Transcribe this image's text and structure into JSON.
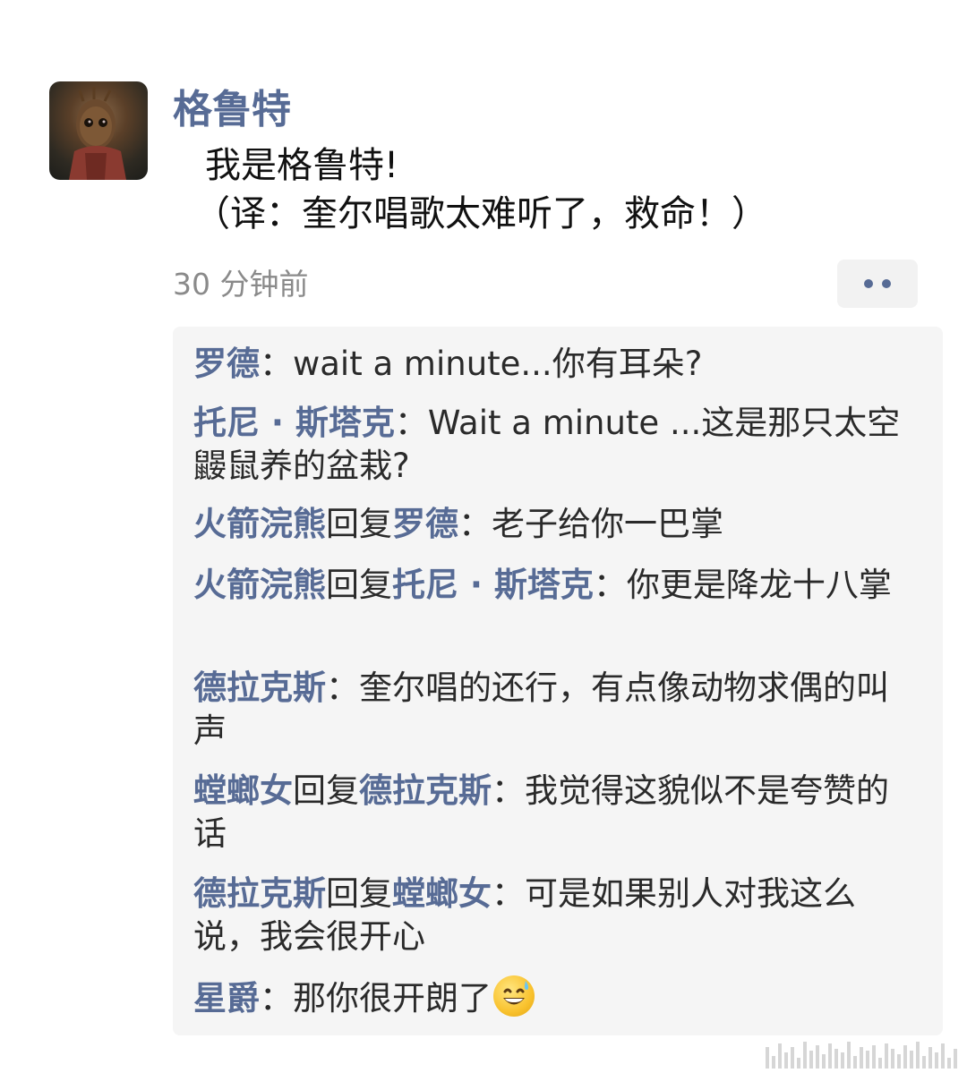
{
  "post": {
    "author": "格鲁特",
    "content_line1": "我是格鲁特!",
    "content_line2": "（译：奎尔唱歌太难听了，救命！）",
    "time": "30 分钟前",
    "avatar_icon": "groot-avatar",
    "more_icon": "more-dots-icon"
  },
  "comments": [
    {
      "user": "罗德",
      "text": "：wait a minute...你有耳朵?"
    },
    {
      "user": "托尼 · 斯塔克",
      "text": "：Wait a minute ...这是那只太空鼹鼠养的盆栽?"
    },
    {
      "user": "火箭浣熊",
      "reply_word": "回复",
      "reply_to": "罗德",
      "text": "：老子给你一巴掌"
    },
    {
      "user": "火箭浣熊",
      "reply_word": "回复",
      "reply_to": "托尼 · 斯塔克",
      "text": "：你更是降龙十八掌"
    },
    {
      "user": "德拉克斯",
      "text": "：奎尔唱的还行，有点像动物求偶的叫声"
    },
    {
      "user": "螳螂女",
      "reply_word": "回复",
      "reply_to": "德拉克斯",
      "text": "：我觉得这貌似不是夸赞的话"
    },
    {
      "user": "德拉克斯",
      "reply_word": "回复",
      "reply_to": "螳螂女",
      "text": "：可是如果别人对我这么说，我会很开心"
    },
    {
      "user": "星爵",
      "text": "：那你很开朗了",
      "emoji": "grinning-sweat-emoji"
    }
  ],
  "colors": {
    "name_link": "#576b95",
    "comment_bg": "#f5f5f5",
    "time_gray": "#8a8a8a"
  }
}
